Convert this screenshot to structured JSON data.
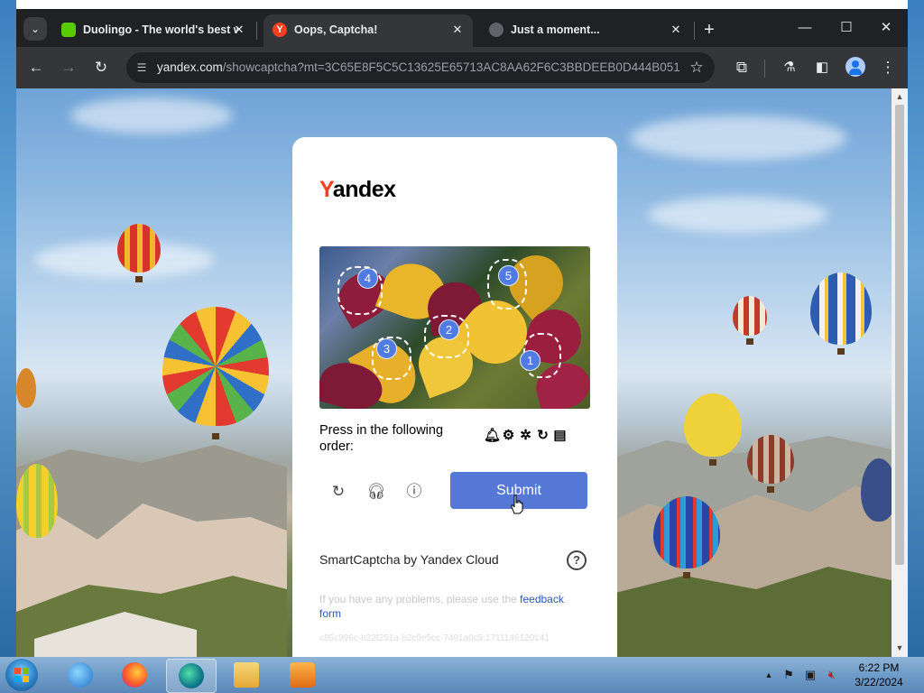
{
  "browser": {
    "tabs": [
      {
        "title": "Duolingo - The world's best w",
        "icon": "duolingo-icon"
      },
      {
        "title": "Oops, Captcha!",
        "icon": "yandex-icon"
      },
      {
        "title": "Just a moment...",
        "icon": "globe-icon"
      }
    ],
    "active_tab": 1,
    "new_tab_symbol": "+",
    "url_host": "yandex.com",
    "url_path": "/showcaptcha?mt=3C65E8F5C5C13625E65713AC8AA62F6C3BBDEEB0D444B051..."
  },
  "captcha": {
    "brand_first": "Y",
    "brand_rest": "andex",
    "markers": [
      "1",
      "2",
      "3",
      "4",
      "5"
    ],
    "instruction": "Press in the following order:",
    "order_icons": [
      "bell-icon",
      "gear-icon",
      "star-icon",
      "refresh-icon",
      "receipt-icon"
    ],
    "submit_label": "Submit",
    "footer_label": "SmartCaptcha by Yandex Cloud",
    "help_symbol": "?",
    "problems_text": "If you have any problems, please use the ",
    "problems_link": "feedback form",
    "request_id": "c85c996c-b22f251a-b2c0e5cc-7491a0c5:1711146120141"
  },
  "taskbar": {
    "time": "6:22 PM",
    "date": "3/22/2024"
  },
  "colors": {
    "submit": "#5578d6",
    "marker": "#4f7be3",
    "brand_red": "#fc3f1d"
  }
}
